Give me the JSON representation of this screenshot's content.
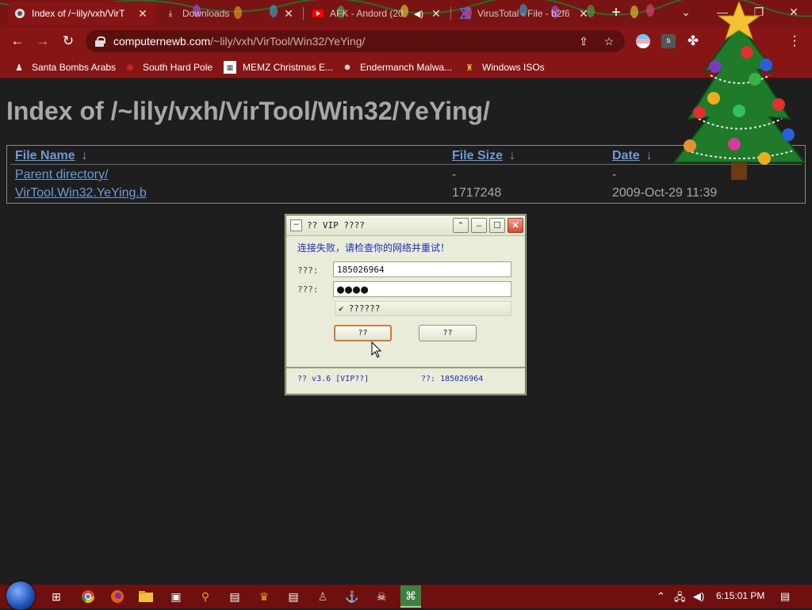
{
  "browser": {
    "tabs": [
      {
        "title": "Index of /~lily/vxh/VirT",
        "icon": "page-favicon",
        "active": true
      },
      {
        "title": "Downloads",
        "icon": "download-icon",
        "active": false
      },
      {
        "title": "AFK - Andord (20",
        "icon": "youtube-icon",
        "active": false
      },
      {
        "title": "VirusTotal - File - b2f6",
        "icon": "virustotal-icon",
        "active": false
      }
    ],
    "new_tab_label": "+",
    "address": {
      "host": "computernewb.com",
      "path": "/~lily/vxh/VirTool/Win32/YeYing/"
    },
    "bookmarks": [
      {
        "label": "Santa Bombs Arabs",
        "icon": "santa-icon"
      },
      {
        "label": "South Hard Pole",
        "icon": "snowflake-icon"
      },
      {
        "label": "MEMZ Christmas E...",
        "icon": "memz-icon"
      },
      {
        "label": "Endermanch Malwa...",
        "icon": "raccoon-icon"
      },
      {
        "label": "Windows ISOs",
        "icon": "trophy-icon"
      }
    ],
    "colors": {
      "theme": "#861616",
      "tabstrip": "#7a1414",
      "link": "#6e9bd6"
    }
  },
  "page": {
    "heading": "Index of /~lily/vxh/VirTool/Win32/YeYing/",
    "columns": [
      "File Name",
      "File Size",
      "Date"
    ],
    "sort_arrow": "↓",
    "rows": [
      {
        "name": "Parent directory/",
        "size": "-",
        "date": "-"
      },
      {
        "name": "VirTool.Win32.YeYing.b",
        "size": "1717248",
        "date": "2009-Oct-29 11:39"
      }
    ]
  },
  "dialog": {
    "title": "?? VIP ????",
    "error": "连接失败，请检查你的网络并重试！",
    "account_label": "???:",
    "account_value": "185026964",
    "password_label": "???:",
    "password_value": "●●●●",
    "checkbox_label": "??????",
    "checkbox_checked": true,
    "ok_label": "??",
    "cancel_label": "??",
    "status_version": "?? v3.6 [VIP??]",
    "status_account": "??: 185026964"
  },
  "taskbar": {
    "clock": "6:15:01 PM",
    "apps": [
      "task-view-icon",
      "chrome-icon",
      "firefox-icon",
      "explorer-icon",
      "app-icon",
      "search-app-icon",
      "file-icon",
      "game-icon",
      "file-icon-2",
      "app-icon-2",
      "app-icon-3",
      "skull-icon",
      "active-app-icon"
    ]
  }
}
